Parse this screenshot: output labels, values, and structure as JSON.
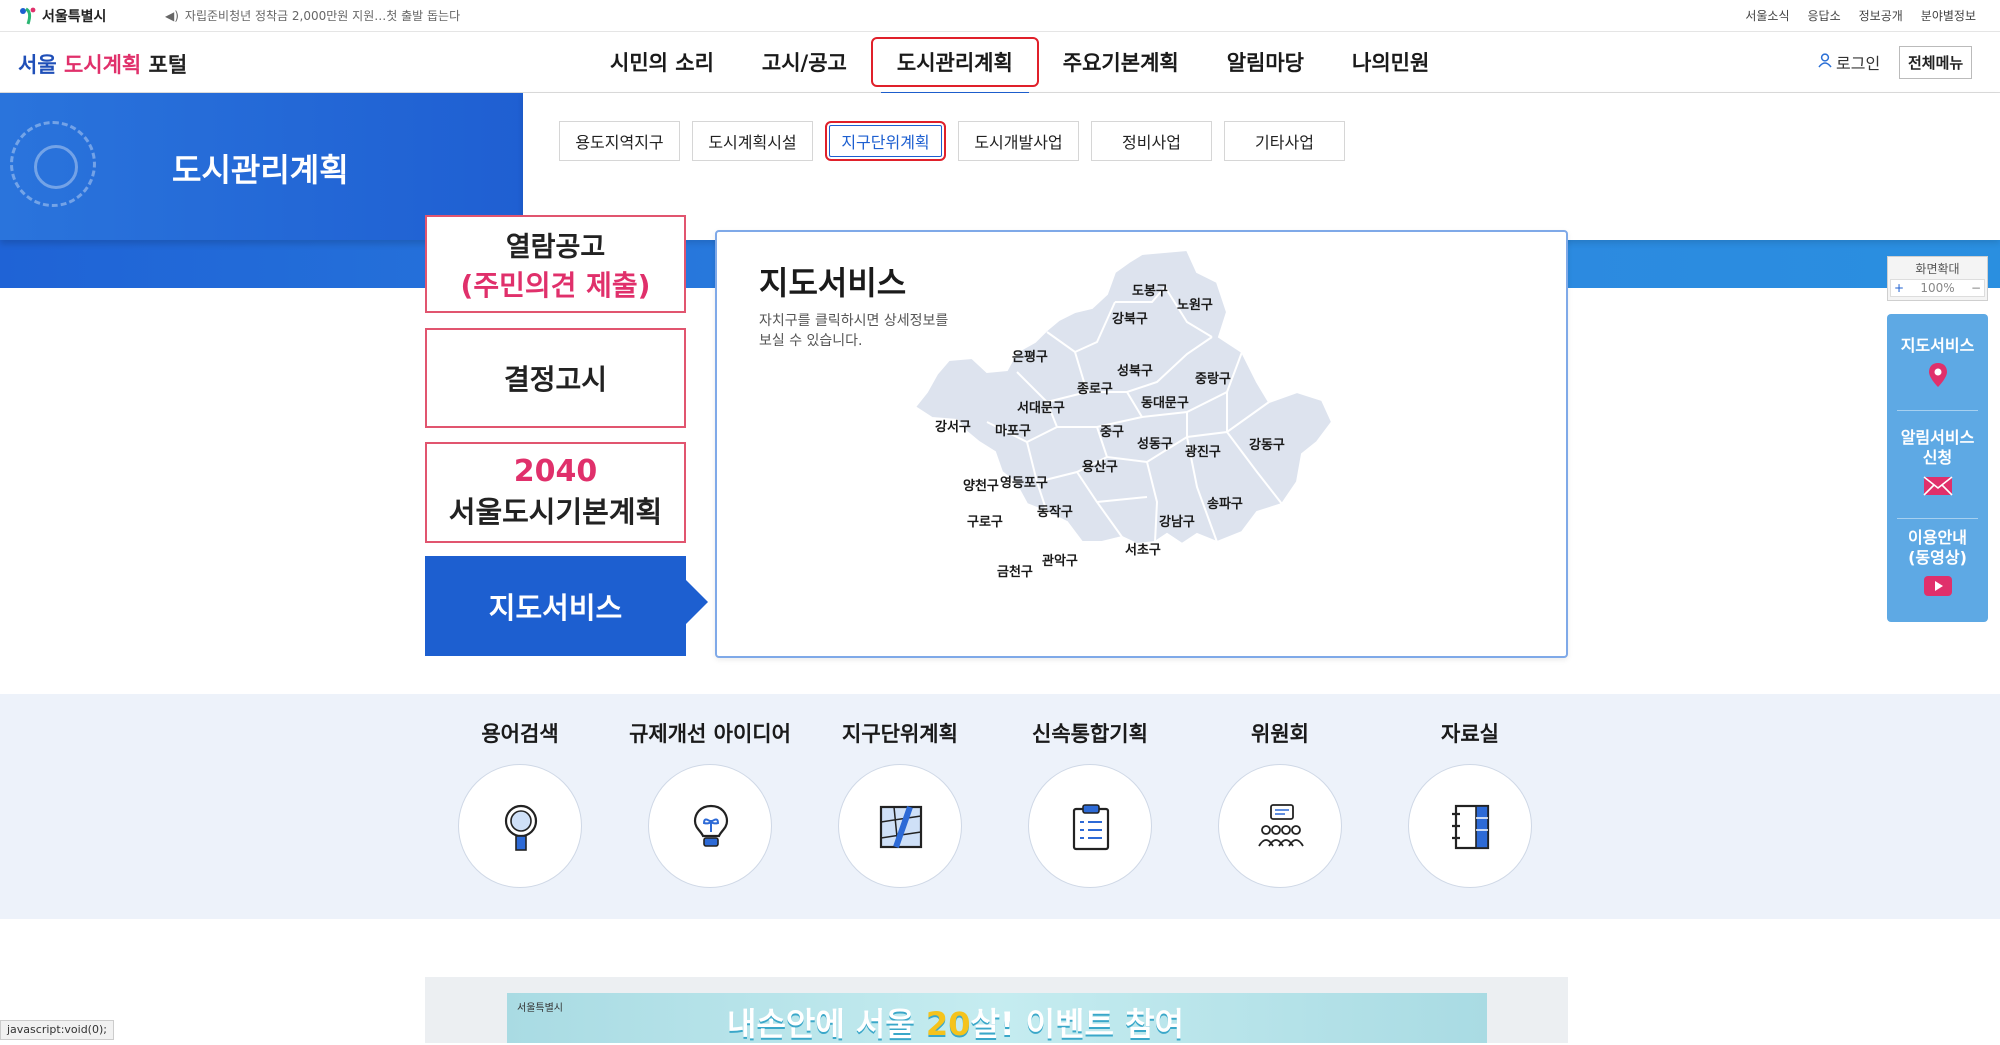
{
  "topbar": {
    "logo_text": "서울특별시",
    "notice": "자립준비청년 정착금 2,000만원 지원…첫 출발 돕는다",
    "links": [
      "서울소식",
      "응답소",
      "정보공개",
      "분야별정보"
    ]
  },
  "header": {
    "logo_part1": "서울",
    "logo_part2": "도시계획",
    "logo_part3": "포털",
    "gnb": [
      "시민의 소리",
      "고시/공고",
      "도시관리계획",
      "주요기본계획",
      "알림마당",
      "나의민원"
    ],
    "login": "로그인",
    "all_menu": "전체메뉴"
  },
  "band": {
    "title": "도시관리계획"
  },
  "submenu": [
    "용도지역지구",
    "도시계획시설",
    "지구단위계획",
    "도시개발사업",
    "정비사업",
    "기타사업"
  ],
  "quick": {
    "q1_line1": "열람공고",
    "q1_line2": "(주민의견 제출)",
    "q2": "결정고시",
    "q3_line1": "2040",
    "q3_line2": "서울도시기본계획",
    "q4": "지도서비스"
  },
  "map": {
    "title": "지도서비스",
    "desc_line1": "자치구를 클릭하시면 상세정보를",
    "desc_line2": "보실 수 있습니다.",
    "districts": [
      "도봉구",
      "노원구",
      "강북구",
      "은평구",
      "성북구",
      "중랑구",
      "종로구",
      "서대문구",
      "동대문구",
      "강서구",
      "마포구",
      "중구",
      "성동구",
      "광진구",
      "강동구",
      "용산구",
      "양천구",
      "영등포구",
      "동작구",
      "강남구",
      "송파구",
      "구로구",
      "서초구",
      "관악구",
      "금천구"
    ]
  },
  "zoom": {
    "label": "화면확대",
    "value": "100%",
    "plus": "+",
    "minus": "−"
  },
  "float": {
    "item1": "지도서비스",
    "item2_line1": "알림서비스",
    "item2_line2": "신청",
    "item3_line1": "이용안내",
    "item3_line2": "(동영상)"
  },
  "shortcuts": [
    "용어검색",
    "규제개선 아이디어",
    "지구단위계획",
    "신속통합기획",
    "위원회",
    "자료실"
  ],
  "banner": {
    "logo": "서울특별시",
    "text_part1": "내손안에 서울",
    "text_part2": "20",
    "text_part3": "살! 이벤트 참여"
  },
  "statusbar": "javascript:void(0);",
  "colors": {
    "primary_blue": "#1d5fd0",
    "accent_pink": "#e0306b",
    "highlight_red": "#e0202a"
  }
}
